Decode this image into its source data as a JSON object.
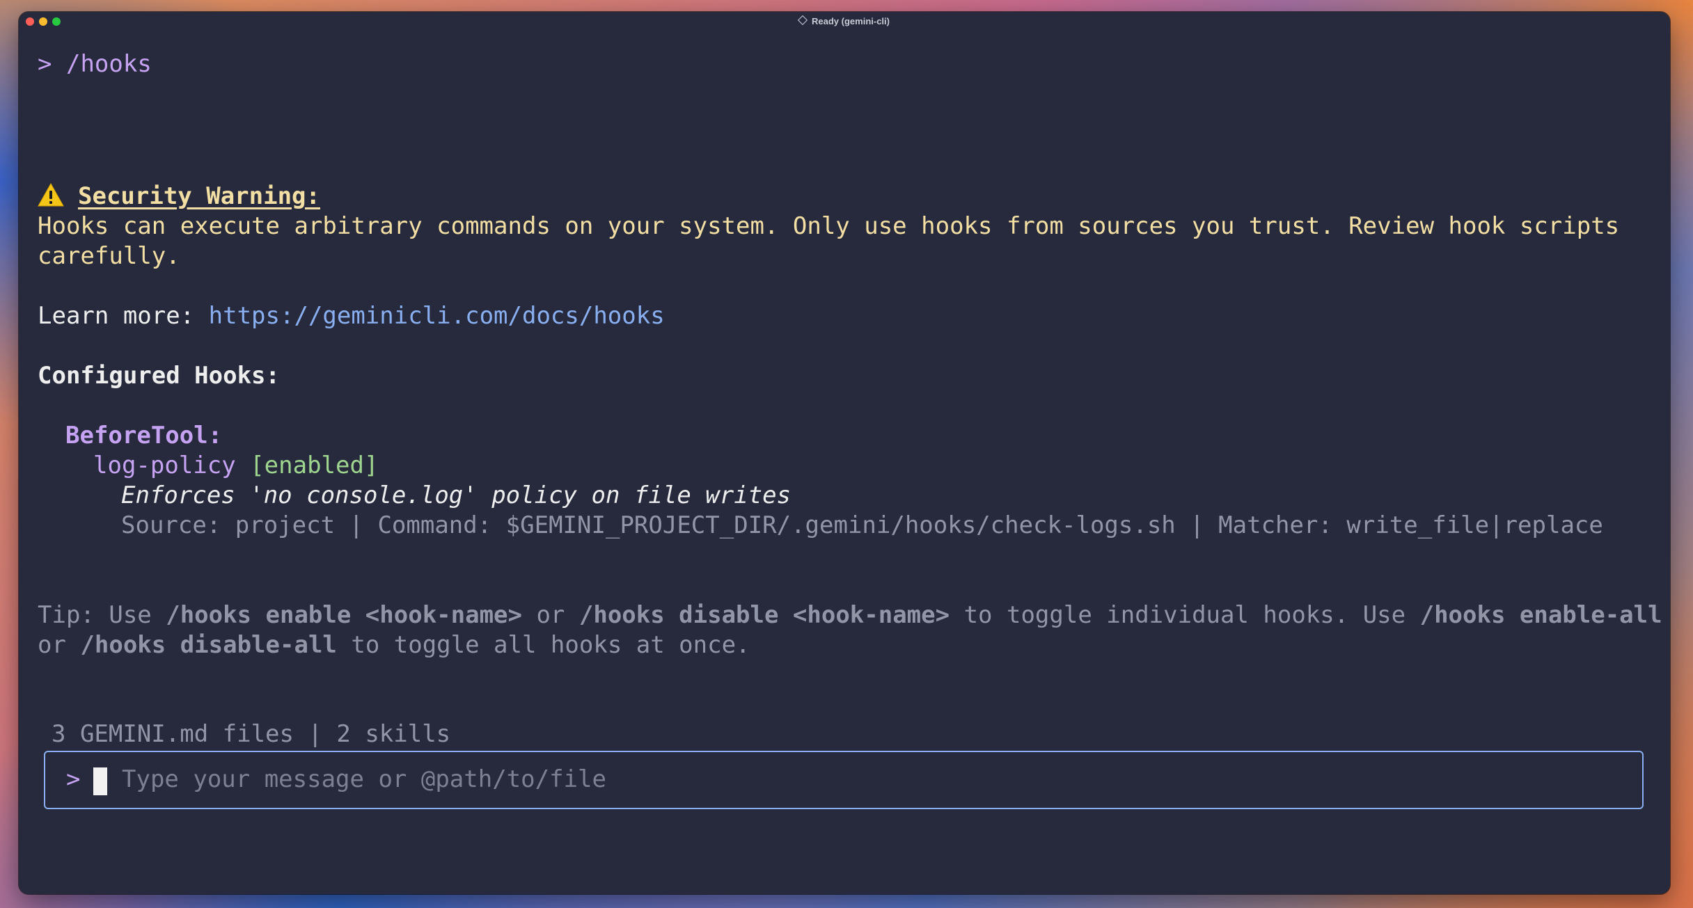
{
  "window": {
    "title": "Ready (gemini-cli)",
    "title_icon": "diamond-icon"
  },
  "command": {
    "prompt": ">",
    "text": "/hooks"
  },
  "warning": {
    "icon": "warning-icon",
    "heading": "Security Warning:",
    "line1": "Hooks can execute arbitrary commands on your system. Only use hooks from sources you trust. Review hook scripts",
    "line2": "carefully."
  },
  "learn_more": {
    "label": "Learn more: ",
    "url": "https://geminicli.com/docs/hooks"
  },
  "configured": {
    "heading": "Configured Hooks:",
    "groups": [
      {
        "event": "BeforeTool:",
        "hooks": [
          {
            "name": "log-policy",
            "status": "[enabled]",
            "description": "Enforces 'no console.log' policy on file writes",
            "details": "Source: project | Command: $GEMINI_PROJECT_DIR/.gemini/hooks/check-logs.sh | Matcher: write_file|replace"
          }
        ]
      }
    ]
  },
  "tip": {
    "l1_a": "Tip: Use ",
    "l1_b": "/hooks enable <hook-name>",
    "l1_c": " or ",
    "l1_d": "/hooks disable <hook-name>",
    "l1_e": " to toggle individual hooks. Use ",
    "l1_f": "/hooks enable-all",
    "l2_a": "or ",
    "l2_b": "/hooks disable-all",
    "l2_c": " to toggle all hooks at once."
  },
  "status_line": "3 GEMINI.md files | 2 skills",
  "input": {
    "prompt": ">",
    "placeholder": "Type your message or @path/to/file"
  },
  "colors": {
    "background": "#272a3c",
    "accent_purple": "#c6a2f2",
    "warning_yellow": "#f3dfa4",
    "link_blue": "#89aff0",
    "enabled_green": "#9fd68f",
    "muted_grey": "#9196a6"
  }
}
